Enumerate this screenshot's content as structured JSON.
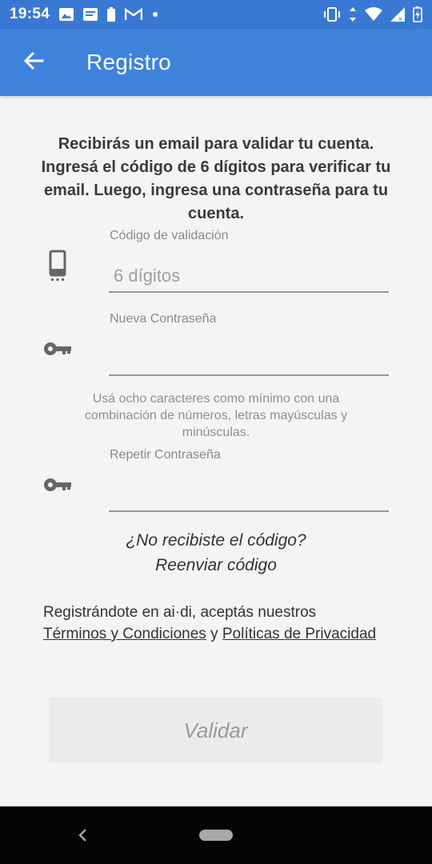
{
  "status_bar": {
    "time": "19:54",
    "icons_left": [
      "image-icon",
      "message-icon",
      "battery-saver-icon",
      "gmail-icon",
      "dot-icon"
    ],
    "icons_right": [
      "vibrate-icon",
      "data-arrows-icon",
      "wifi-icon",
      "signal-icon",
      "battery-icon"
    ]
  },
  "app_bar": {
    "title": "Registro",
    "color": "#3f82dc"
  },
  "intro_text": "Recibirás un email para validar tu cuenta. Ingresá el código de 6 dígitos para verificar tu email. Luego, ingresa una contraseña para tu cuenta.",
  "fields": {
    "code": {
      "label": "Código de validación",
      "placeholder": "6 dígitos",
      "value": "",
      "icon": "phone-icon"
    },
    "new_password": {
      "label": "Nueva Contraseña",
      "placeholder": "",
      "value": "",
      "icon": "key-icon"
    },
    "repeat_password": {
      "label": "Repetir Contraseña",
      "placeholder": "",
      "value": "",
      "icon": "key-icon"
    }
  },
  "password_hint": "Usá ocho caracteres como mínimo con una combinación de números, letras mayúsculas y minúsculas.",
  "resend": {
    "question": "¿No recibiste el código?",
    "link": "Reenviar código"
  },
  "terms": {
    "prefix": "Registrándote en ai·di, aceptás nuestros ",
    "terms_link": "Términos y Condiciones",
    "connector": " y ",
    "privacy_link": "Políticas de Privacidad"
  },
  "validate_button": "Validar"
}
